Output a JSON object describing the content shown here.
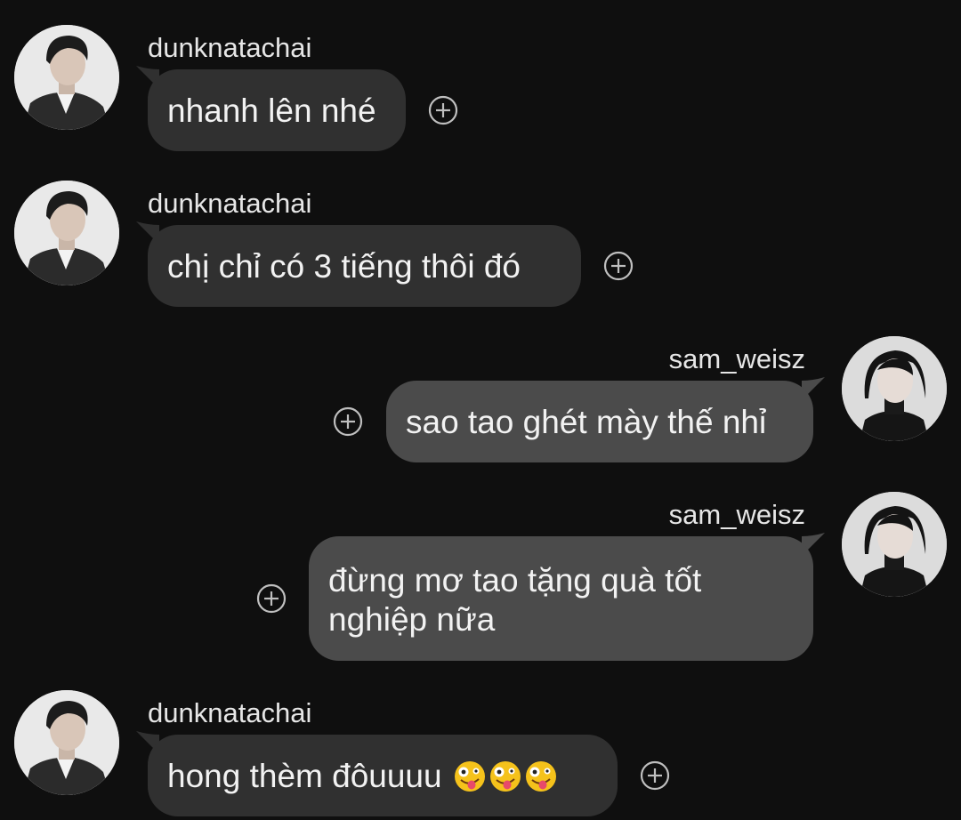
{
  "messages": [
    {
      "sender": "dunknatachai",
      "text": "nhanh lên nhé",
      "direction": "incoming"
    },
    {
      "sender": "dunknatachai",
      "text": "chị chỉ có 3 tiếng thôi đó",
      "direction": "incoming"
    },
    {
      "sender": "sam_weisz",
      "text": "sao tao ghét mày thế nhỉ",
      "direction": "outgoing"
    },
    {
      "sender": "sam_weisz",
      "text": "đừng mơ tao tặng quà tốt nghiệp nữa",
      "direction": "outgoing"
    },
    {
      "sender": "dunknatachai",
      "text": "hong thèm đôuuuu",
      "direction": "incoming",
      "emojis": [
        "zany-face",
        "zany-face",
        "zany-face"
      ]
    }
  ],
  "icons": {
    "reaction": "add-reaction-icon",
    "avatar_incoming": "avatar-dunknatachai",
    "avatar_outgoing": "avatar-sam-weisz"
  },
  "colors": {
    "background": "#0f0f0f",
    "incoming_bubble": "#303030",
    "outgoing_bubble": "#4b4b4b",
    "text": "#f2f2f2"
  }
}
